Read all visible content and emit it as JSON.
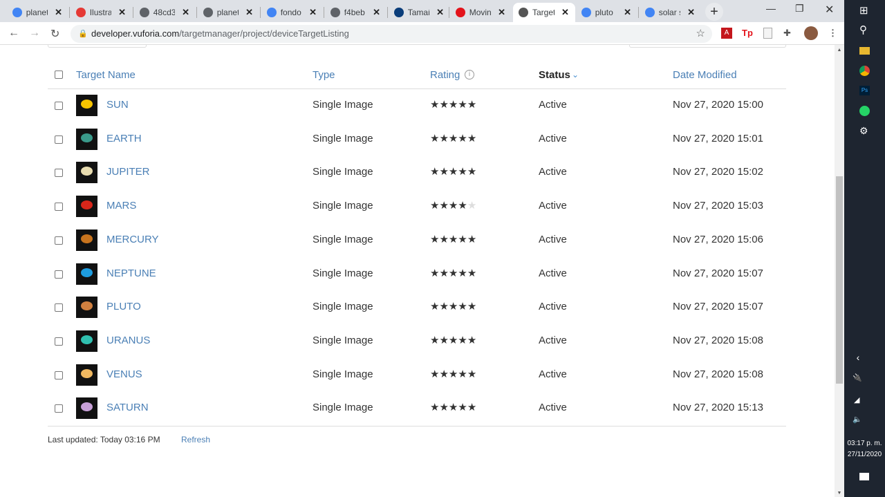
{
  "browser": {
    "tabs": [
      {
        "label": "planet",
        "icon": "google-icon",
        "color": "#4285f4"
      },
      {
        "label": "Ilustra",
        "icon": "ilustra-icon",
        "color": "#e53935"
      },
      {
        "label": "48cd3",
        "icon": "globe-icon",
        "color": "#5f6368"
      },
      {
        "label": "planet",
        "icon": "globe-icon",
        "color": "#5f6368"
      },
      {
        "label": "fondo",
        "icon": "google-icon",
        "color": "#4285f4"
      },
      {
        "label": "f4beb",
        "icon": "globe-icon",
        "color": "#5f6368"
      },
      {
        "label": "Tamañ",
        "icon": "vuforia-v-icon",
        "color": "#0a3d7a"
      },
      {
        "label": "Movin",
        "icon": "adobe-icon",
        "color": "#e3131b"
      },
      {
        "label": "Target",
        "icon": "vuforia-icon",
        "color": "#555555",
        "active": true
      },
      {
        "label": "pluto",
        "icon": "google-icon",
        "color": "#4285f4"
      },
      {
        "label": "solar s",
        "icon": "google-icon",
        "color": "#4285f4"
      }
    ],
    "url_domain": "developer.vuforia.com",
    "url_path": "/targetmanager/project/deviceTargetListing"
  },
  "table": {
    "headers": {
      "name": "Target Name",
      "type": "Type",
      "rating": "Rating",
      "status": "Status",
      "date": "Date Modified"
    },
    "sorted_by": "Status",
    "rows": [
      {
        "name": "SUN",
        "type": "Single Image",
        "rating": 5,
        "status": "Active",
        "date": "Nov 27, 2020 15:00",
        "color": "#f8c400"
      },
      {
        "name": "EARTH",
        "type": "Single Image",
        "rating": 5,
        "status": "Active",
        "date": "Nov 27, 2020 15:01",
        "color": "#3a9a8a"
      },
      {
        "name": "JUPITER",
        "type": "Single Image",
        "rating": 5,
        "status": "Active",
        "date": "Nov 27, 2020 15:02",
        "color": "#e8dcb0"
      },
      {
        "name": "MARS",
        "type": "Single Image",
        "rating": 4,
        "status": "Active",
        "date": "Nov 27, 2020 15:03",
        "color": "#d8261a"
      },
      {
        "name": "MERCURY",
        "type": "Single Image",
        "rating": 5,
        "status": "Active",
        "date": "Nov 27, 2020 15:06",
        "color": "#c8741e"
      },
      {
        "name": "NEPTUNE",
        "type": "Single Image",
        "rating": 5,
        "status": "Active",
        "date": "Nov 27, 2020 15:07",
        "color": "#1e9de0"
      },
      {
        "name": "PLUTO",
        "type": "Single Image",
        "rating": 5,
        "status": "Active",
        "date": "Nov 27, 2020 15:07",
        "color": "#d08040"
      },
      {
        "name": "URANUS",
        "type": "Single Image",
        "rating": 5,
        "status": "Active",
        "date": "Nov 27, 2020 15:08",
        "color": "#30c0b0"
      },
      {
        "name": "VENUS",
        "type": "Single Image",
        "rating": 5,
        "status": "Active",
        "date": "Nov 27, 2020 15:08",
        "color": "#f0b860"
      },
      {
        "name": "SATURN",
        "type": "Single Image",
        "rating": 5,
        "status": "Active",
        "date": "Nov 27, 2020 15:13",
        "color": "#c8a0d8"
      }
    ]
  },
  "footer": {
    "last_updated": "Last updated: Today 03:16 PM",
    "refresh": "Refresh"
  },
  "taskbar": {
    "time": "03:17 p. m.",
    "date": "27/11/2020"
  }
}
